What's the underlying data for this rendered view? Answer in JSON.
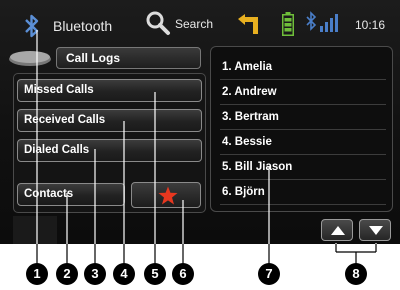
{
  "status_bar": {
    "title": "Bluetooth",
    "search_label": "Search",
    "time": "10:16",
    "icons": [
      "bluetooth-icon",
      "search-icon",
      "navigation-turn-icon",
      "battery-icon",
      "signal-strength-icon"
    ]
  },
  "header": {
    "title": "Call Logs"
  },
  "menu": {
    "missed_calls": "Missed Calls",
    "received_calls": "Received Calls",
    "dialed_calls": "Dialed Calls",
    "contacts": "Contacts",
    "favorites_icon": "star-icon"
  },
  "contacts": [
    "1. Amelia",
    "2. Andrew",
    "3. Bertram",
    "4. Bessie",
    "5. Bill Jiason",
    "6. Björn"
  ],
  "scroll": {
    "up_icon": "arrow-up-icon",
    "down_icon": "arrow-down-icon"
  },
  "callouts": [
    "1",
    "2",
    "3",
    "4",
    "5",
    "6",
    "7",
    "8"
  ],
  "colors": {
    "background": "#101010",
    "text": "#ffffff",
    "accent_blue": "#4a7ec8",
    "star": "#e8371f",
    "battery": "#6fbf3a",
    "nav_arrow": "#e8b020"
  }
}
